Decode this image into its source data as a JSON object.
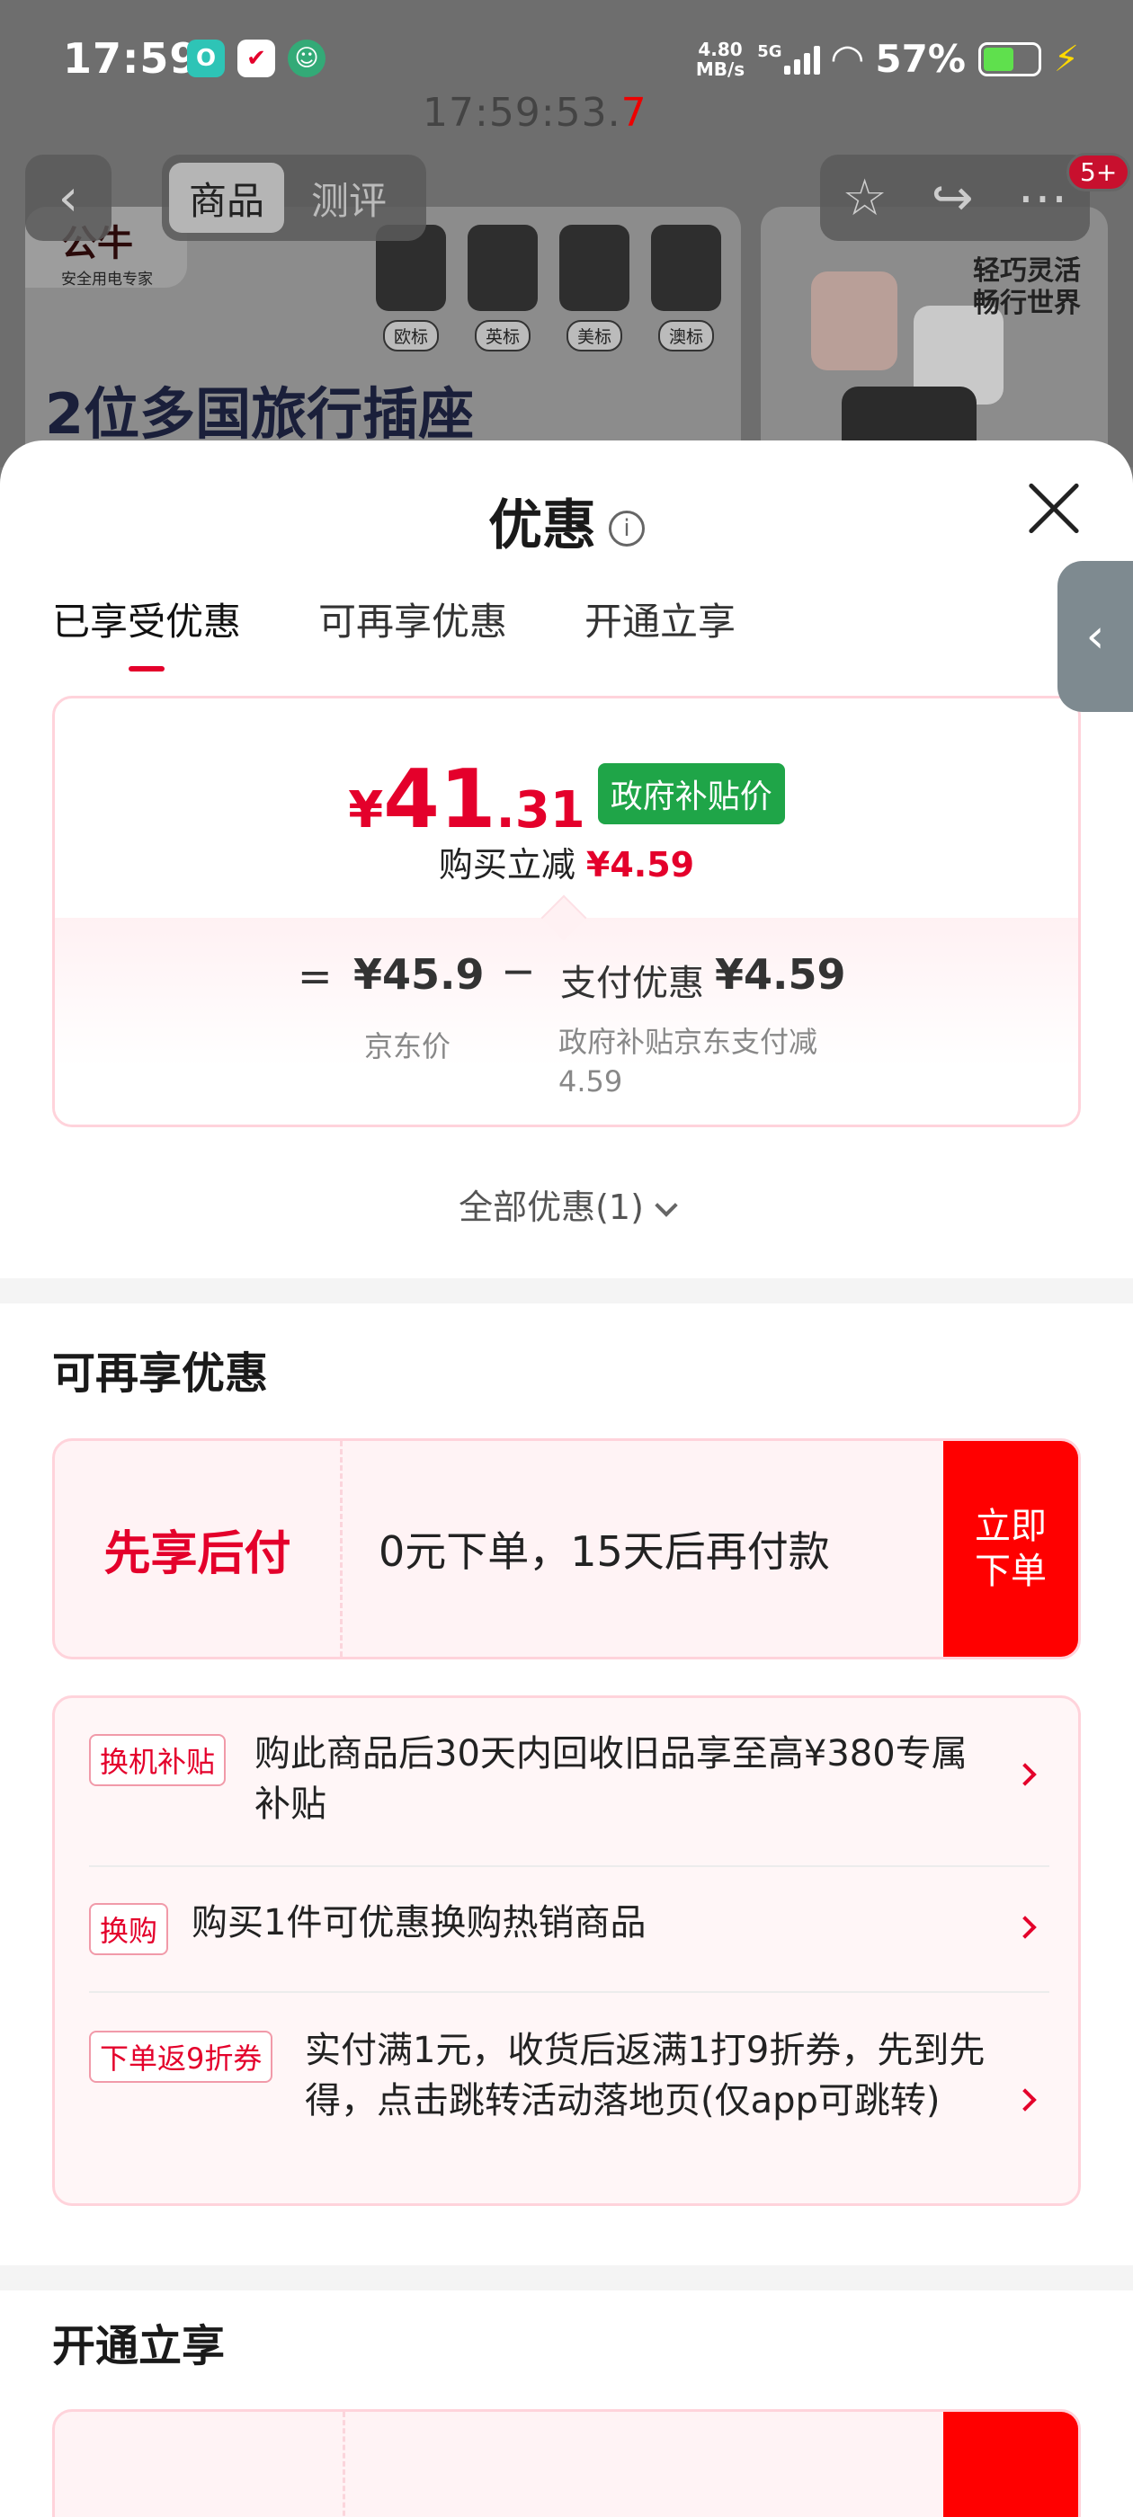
{
  "status_bar": {
    "time": "17:59",
    "net_speed": "4.80",
    "net_unit": "MB/s",
    "network": "5G",
    "battery": "57%"
  },
  "overlay_clock": {
    "main": "17:59:53.",
    "last": "7"
  },
  "nav": {
    "tabs": [
      "商品",
      "测评"
    ],
    "badge": "5+"
  },
  "banner": {
    "brand": "公牛",
    "brand_sub": "安全用电专家",
    "title": "2位多国旅行插座",
    "plug_labels": [
      "欧标",
      "英标",
      "美标",
      "澳标"
    ],
    "right_text": "轻巧灵活\n畅行世界"
  },
  "sheet": {
    "title": "优惠",
    "info_icon": "i",
    "tabs": [
      "已享受优惠",
      "可再享优惠",
      "开通立享"
    ],
    "price": {
      "yen": "¥",
      "integer": "41",
      "decimal": ".31",
      "tag": "政府补贴价",
      "reduce_label": "购买立减",
      "reduce_value": "¥4.59"
    },
    "formula": {
      "eq": "=",
      "jd_price": "¥45.9",
      "jd_price_label": "京东价",
      "minus": "−",
      "pay_label": "支付优惠",
      "pay_value": "¥4.59",
      "pay_sub": "政府补贴京东支付减4.59"
    },
    "all_offers": "全部优惠(1)",
    "more_section": {
      "title": "可再享优惠",
      "paylater": {
        "label": "先享后付",
        "desc": "0元下单，15天后再付款",
        "button": "立即下单"
      },
      "offers": [
        {
          "tag": "换机补贴",
          "text": "购此商品后30天内回收旧品享至高¥380专属补贴"
        },
        {
          "tag": "换购",
          "text": "购买1件可优惠换购热销商品"
        },
        {
          "tag": "下单返9折券",
          "text": "实付满1元，收货后返满1打9折券，先到先得，点击跳转活动落地页(仅app可跳转)"
        }
      ]
    },
    "open_section": {
      "title": "开通立享"
    }
  }
}
